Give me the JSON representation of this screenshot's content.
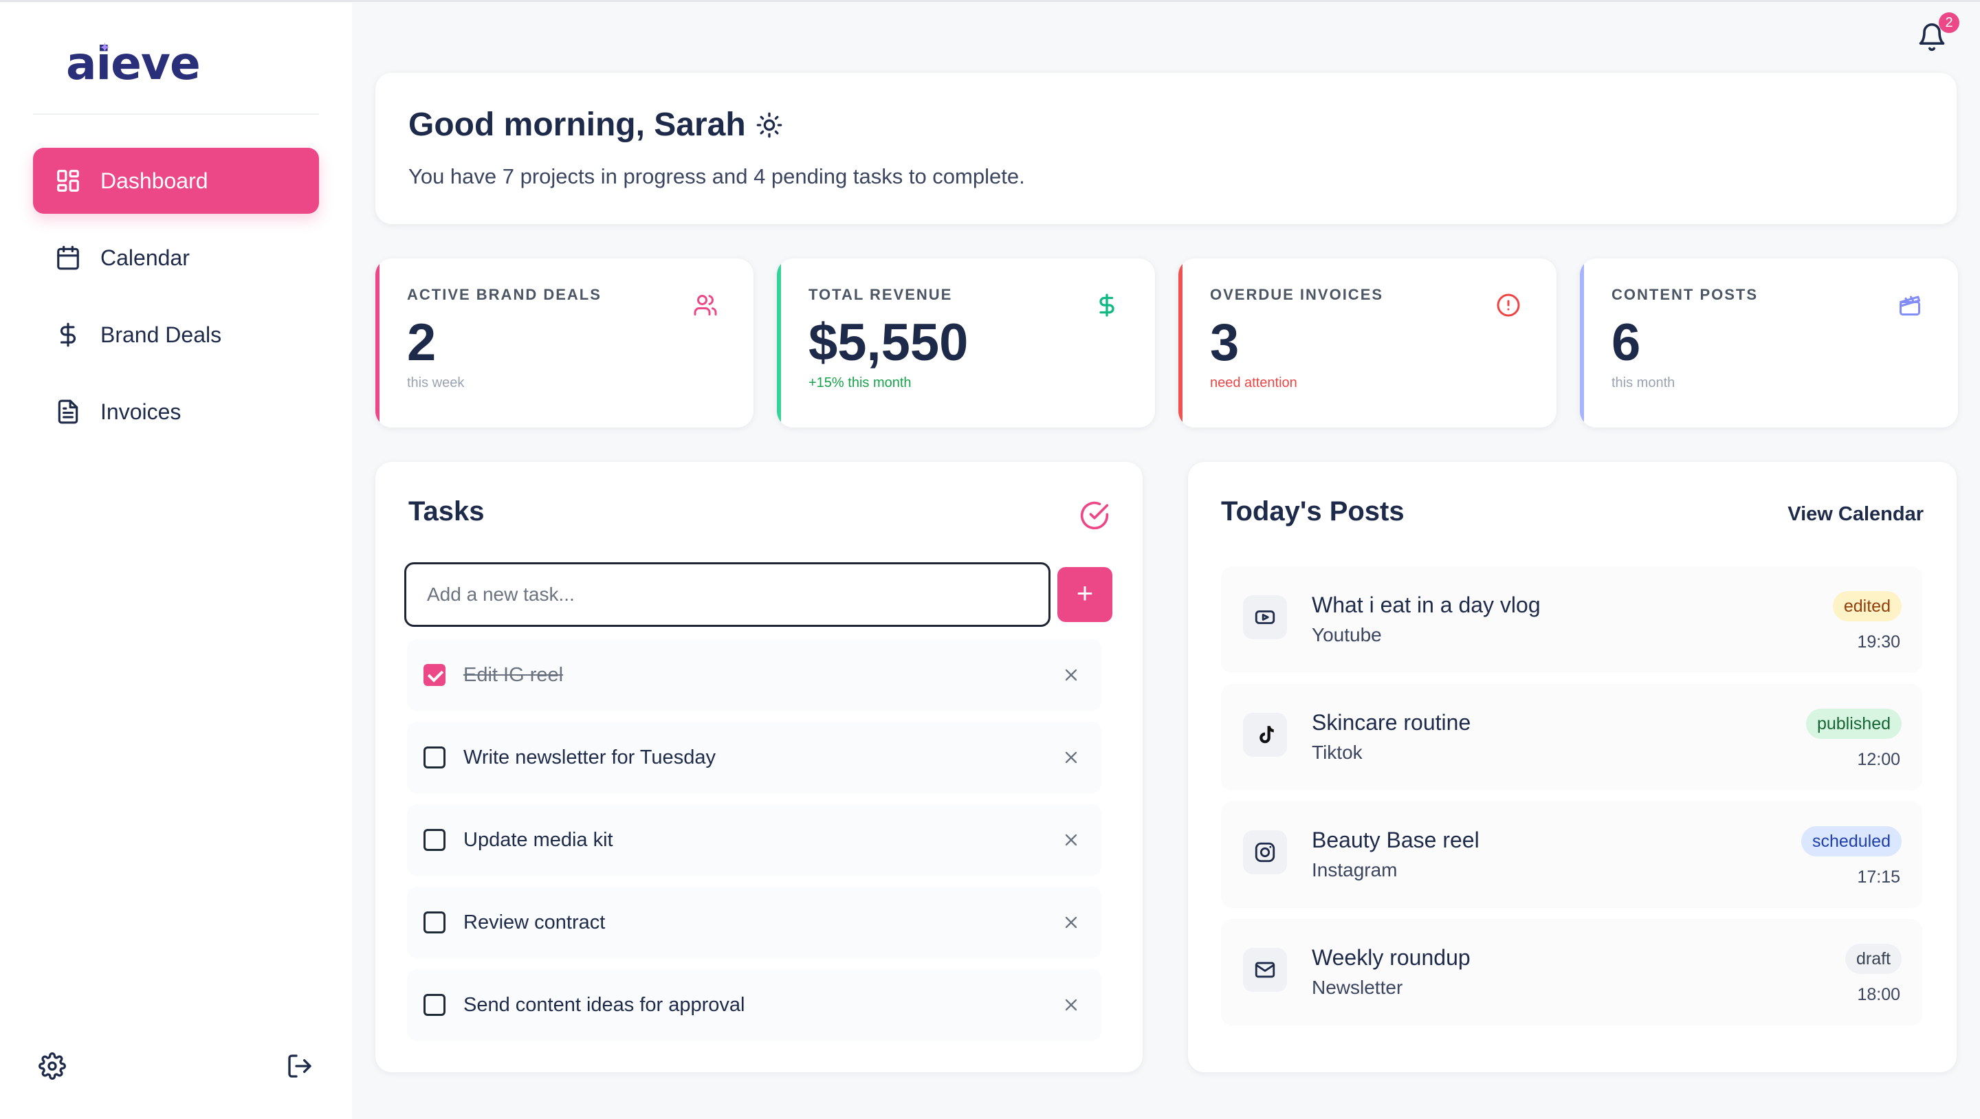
{
  "app": {
    "logo": "aieve"
  },
  "sidebar": {
    "items": [
      {
        "label": "Dashboard",
        "icon": "grid-icon",
        "active": true
      },
      {
        "label": "Calendar",
        "icon": "calendar-icon"
      },
      {
        "label": "Brand Deals",
        "icon": "dollar-icon"
      },
      {
        "label": "Invoices",
        "icon": "document-icon"
      }
    ],
    "bottom_icons": [
      "gear-icon",
      "logout-icon"
    ]
  },
  "header": {
    "notification_count": "2"
  },
  "greeting": {
    "title": "Good morning, Sarah",
    "subtitle": "You have 7 projects in progress and 4 pending tasks to complete."
  },
  "stats": [
    {
      "label": "ACTIVE BRAND DEALS",
      "value": "2",
      "note": "this week",
      "icon": "users-icon",
      "color": "#ec4887"
    },
    {
      "label": "TOTAL REVENUE",
      "value": "$5,550",
      "note": "+15% this month",
      "icon": "dollar-icon",
      "color": "#34d399"
    },
    {
      "label": "OVERDUE INVOICES",
      "value": "3",
      "note": "need attention",
      "icon": "alert-circle-icon",
      "color": "#f05252"
    },
    {
      "label": "CONTENT POSTS",
      "value": "6",
      "note": "this month",
      "icon": "clapperboard-icon",
      "color": "#a5b4fc"
    }
  ],
  "tasks": {
    "title": "Tasks",
    "input_placeholder": "Add a new task...",
    "add_label": "+",
    "items": [
      {
        "text": "Edit IG reel",
        "done": true
      },
      {
        "text": "Write newsletter for Tuesday",
        "done": false
      },
      {
        "text": "Update media kit",
        "done": false
      },
      {
        "text": "Review contract",
        "done": false
      },
      {
        "text": "Send content ideas for approval",
        "done": false
      }
    ]
  },
  "posts": {
    "title": "Today's Posts",
    "view_calendar": "View Calendar",
    "items": [
      {
        "title": "What i eat in a day vlog",
        "platform": "Youtube",
        "status": "edited",
        "time": "19:30",
        "icon": "youtube-icon"
      },
      {
        "title": "Skincare routine",
        "platform": "Tiktok",
        "status": "published",
        "time": "12:00",
        "icon": "tiktok-icon"
      },
      {
        "title": "Beauty Base reel",
        "platform": "Instagram",
        "status": "scheduled",
        "time": "17:15",
        "icon": "instagram-icon"
      },
      {
        "title": "Weekly roundup",
        "platform": "Newsletter",
        "status": "draft",
        "time": "18:00",
        "icon": "mail-icon"
      }
    ]
  }
}
